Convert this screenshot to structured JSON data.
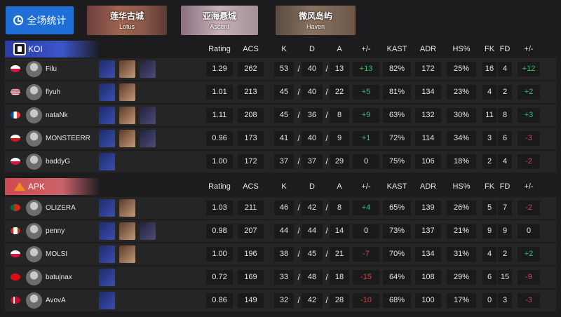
{
  "overall_button": {
    "label": "全场统计",
    "icon": "clock-icon"
  },
  "map_tabs": [
    {
      "name_cn": "莲华古城",
      "name_en": "Lotus"
    },
    {
      "name_cn": "亚海悬城",
      "name_en": "Ascent"
    },
    {
      "name_cn": "微风岛屿",
      "name_en": "Haven"
    }
  ],
  "columns": [
    "Rating",
    "ACS",
    "K",
    "D",
    "A",
    "+/-",
    "KAST",
    "ADR",
    "HS%",
    "FK",
    "FD",
    "+/-"
  ],
  "colors": {
    "positive": "#2fbf71",
    "negative": "#d9434b",
    "accent": "#1f6fd6"
  },
  "teams": [
    {
      "name": "KOI",
      "logo": "koi-logo-icon",
      "players": [
        {
          "flag": "PL",
          "name": "Filu",
          "agents": [
            "agent-icon-1",
            "agent-icon-2",
            "agent-icon-3"
          ],
          "rating": "1.29",
          "acs": "262",
          "k": "53",
          "d": "40",
          "a": "13",
          "kd_diff": "+13",
          "kast": "82%",
          "adr": "172",
          "hs": "25%",
          "fk": "16",
          "fd": "4",
          "fkfd_diff": "+12"
        },
        {
          "flag": "US",
          "name": "flyuh",
          "agents": [
            "agent-icon-1",
            "agent-icon-2"
          ],
          "rating": "1.01",
          "acs": "213",
          "k": "45",
          "d": "40",
          "a": "22",
          "kd_diff": "+5",
          "kast": "81%",
          "adr": "134",
          "hs": "23%",
          "fk": "4",
          "fd": "2",
          "fkfd_diff": "+2"
        },
        {
          "flag": "FR",
          "name": "nataNk",
          "agents": [
            "agent-icon-1",
            "agent-icon-2",
            "agent-icon-3"
          ],
          "rating": "1.11",
          "acs": "208",
          "k": "45",
          "d": "36",
          "a": "8",
          "kd_diff": "+9",
          "kast": "63%",
          "adr": "132",
          "hs": "30%",
          "fk": "11",
          "fd": "8",
          "fkfd_diff": "+3"
        },
        {
          "flag": "CZ",
          "name": "MONSTEERR",
          "agents": [
            "agent-icon-1",
            "agent-icon-2",
            "agent-icon-3"
          ],
          "rating": "0.96",
          "acs": "173",
          "k": "41",
          "d": "40",
          "a": "9",
          "kd_diff": "+1",
          "kast": "72%",
          "adr": "114",
          "hs": "34%",
          "fk": "3",
          "fd": "6",
          "fkfd_diff": "-3"
        },
        {
          "flag": "PL",
          "name": "baddyG",
          "agents": [
            "agent-icon-1"
          ],
          "rating": "1.00",
          "acs": "172",
          "k": "37",
          "d": "37",
          "a": "29",
          "kd_diff": "0",
          "kast": "75%",
          "adr": "106",
          "hs": "18%",
          "fk": "2",
          "fd": "4",
          "fkfd_diff": "-2"
        }
      ]
    },
    {
      "name": "APK",
      "logo": "apk-logo-icon",
      "players": [
        {
          "flag": "PT",
          "name": "OLIZERA",
          "agents": [
            "agent-icon-1",
            "agent-icon-2"
          ],
          "rating": "1.03",
          "acs": "211",
          "k": "46",
          "d": "42",
          "a": "8",
          "kd_diff": "+4",
          "kast": "65%",
          "adr": "139",
          "hs": "26%",
          "fk": "5",
          "fd": "7",
          "fkfd_diff": "-2"
        },
        {
          "flag": "CA",
          "name": "penny",
          "agents": [
            "agent-icon-1",
            "agent-icon-2",
            "agent-icon-3"
          ],
          "rating": "0.98",
          "acs": "207",
          "k": "44",
          "d": "44",
          "a": "14",
          "kd_diff": "0",
          "kast": "73%",
          "adr": "137",
          "hs": "21%",
          "fk": "9",
          "fd": "9",
          "fkfd_diff": "0"
        },
        {
          "flag": "PL",
          "name": "MOLSI",
          "agents": [
            "agent-icon-1",
            "agent-icon-2"
          ],
          "rating": "1.00",
          "acs": "196",
          "k": "38",
          "d": "45",
          "a": "21",
          "kd_diff": "-7",
          "kast": "70%",
          "adr": "134",
          "hs": "31%",
          "fk": "4",
          "fd": "2",
          "fkfd_diff": "+2"
        },
        {
          "flag": "TR",
          "name": "batujnax",
          "agents": [
            "agent-icon-1"
          ],
          "rating": "0.72",
          "acs": "169",
          "k": "33",
          "d": "48",
          "a": "18",
          "kd_diff": "-15",
          "kast": "64%",
          "adr": "108",
          "hs": "29%",
          "fk": "6",
          "fd": "15",
          "fkfd_diff": "-9"
        },
        {
          "flag": "DK",
          "name": "AvovA",
          "agents": [
            "agent-icon-1"
          ],
          "rating": "0.86",
          "acs": "149",
          "k": "32",
          "d": "42",
          "a": "28",
          "kd_diff": "-10",
          "kast": "68%",
          "adr": "100",
          "hs": "17%",
          "fk": "0",
          "fd": "3",
          "fkfd_diff": "-3"
        }
      ]
    }
  ]
}
